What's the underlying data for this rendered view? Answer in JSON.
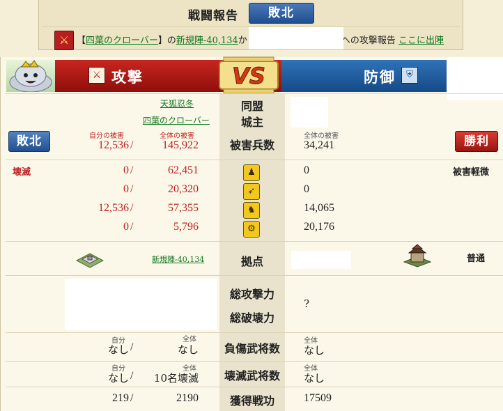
{
  "header": {
    "title": "戦闘報告",
    "result": "敗北",
    "message": {
      "prefix": "【",
      "alliance": "四葉のクローバー",
      "mid1": "】の",
      "base_link": "新規陣-40,134",
      "mid2": "から",
      "suffix": "への攻撃報告",
      "sortie_link": "ここに出陣"
    }
  },
  "banner": {
    "attack_label": "攻撃",
    "vs": "VS",
    "defense_label": "防御"
  },
  "attacker": {
    "player_link": "天狐忍冬",
    "alliance_link": "四葉のクローバー",
    "result": "敗北",
    "own_loss_label": "自分の被害",
    "total_loss_label": "全体の被害",
    "own_loss": "12,536",
    "total_loss": "145,922",
    "status": "壊滅",
    "unit_rows": [
      {
        "own": "0",
        "total": "62,451"
      },
      {
        "own": "0",
        "total": "20,320"
      },
      {
        "own": "12,536",
        "total": "57,355"
      },
      {
        "own": "0",
        "total": "5,796"
      }
    ],
    "base_link": "新規陣-40,134",
    "injured": {
      "self_label": "自分",
      "all_label": "全体",
      "self": "なし",
      "all": "なし"
    },
    "destroyed": {
      "self_label": "自分",
      "all_label": "全体",
      "self": "なし",
      "all": "10名壊滅"
    },
    "merit": {
      "self": "219",
      "all": "2190"
    }
  },
  "center": {
    "alliance": "同盟",
    "lord": "城主",
    "casualties": "被害兵数",
    "base": "拠点",
    "total_attack": "総攻撃力",
    "total_destruction": "総破壊力",
    "injured_generals": "負傷武将数",
    "destroyed_generals": "壊滅武将数",
    "merit": "獲得戦功",
    "unit_icons": [
      "spearman-icon",
      "archer-icon",
      "cavalry-icon",
      "siege-icon"
    ]
  },
  "defender": {
    "result": "勝利",
    "total_loss_label": "全体の被害",
    "total_loss": "34,241",
    "status": "被害軽微",
    "unit_rows": [
      "0",
      "0",
      "14,065",
      "20,176"
    ],
    "base_type": "普通",
    "power": "?",
    "all_label": "全体",
    "injured": "なし",
    "destroyed": "なし",
    "merit": "17509"
  },
  "slash": "/",
  "colors": {
    "attack_red": "#c02020",
    "defense_blue": "#1f4f91",
    "link_green": "#11771f"
  }
}
